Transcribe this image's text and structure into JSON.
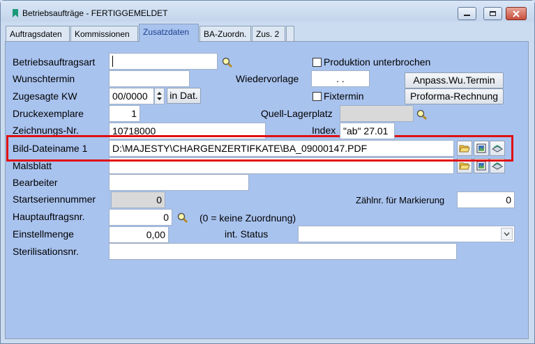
{
  "window": {
    "title": "Betriebsaufträge - FERTIGGEMELDET"
  },
  "tabs": [
    {
      "label": "Auftragsdaten",
      "active": false
    },
    {
      "label": "Kommissionen",
      "active": false
    },
    {
      "label": "Zusatzdaten",
      "active": true
    },
    {
      "label": "BA-Zuordn.",
      "active": false
    },
    {
      "label": "Zus. 2",
      "active": false
    }
  ],
  "form": {
    "betriebsauftragsart": {
      "label": "Betriebsauftragsart",
      "value": ""
    },
    "wunschtermin": {
      "label": "Wunschtermin",
      "value": ""
    },
    "zugesagte_kw": {
      "label": "Zugesagte KW",
      "value": "00/0000",
      "button": "in Dat."
    },
    "druckexemplare": {
      "label": "Druckexemplare",
      "value": "1"
    },
    "zeichnungs_nr": {
      "label": "Zeichnungs-Nr.",
      "value": "10718000"
    },
    "bild_dateiname": {
      "label": "Bild-Dateiname 1",
      "value": "D:\\MAJESTY\\CHARGENZERTIFKATE\\BA_09000147.PDF"
    },
    "malsblatt": {
      "label": "Malsblatt",
      "value": ""
    },
    "bearbeiter": {
      "label": "Bearbeiter",
      "value": ""
    },
    "startseriennummer": {
      "label": "Startseriennummer",
      "value": "0"
    },
    "hauptauftragsnr": {
      "label": "Hauptauftragsnr.",
      "value": "0",
      "hint": "(0 = keine Zuordnung)"
    },
    "einstellmenge": {
      "label": "Einstellmenge",
      "value": "0,00"
    },
    "sterilisationsnr": {
      "label": "Sterilisationsnr.",
      "value": ""
    },
    "produktion_unterbrochen": {
      "label": "Produktion unterbrochen",
      "checked": false
    },
    "wiedervorlage": {
      "label": "Wiedervorlage",
      "value": " .  ."
    },
    "fixtermin": {
      "label": "Fixtermin",
      "checked": false
    },
    "quell_lagerplatz": {
      "label": "Quell-Lagerplatz",
      "value": ""
    },
    "index": {
      "label": "Index",
      "value": "\"ab\" 27.01"
    },
    "zaehlnr": {
      "label": "Zählnr. für Markierung",
      "value": "0"
    },
    "int_status": {
      "label": "int. Status",
      "value": ""
    },
    "anpass_button": "Anpass.Wu.Termin",
    "proforma_button": "Proforma-Rechnung"
  },
  "colors": {
    "panel": "#a9c3ef",
    "highlight": "#e01010",
    "active_tab_text": "#1e3e8a"
  }
}
